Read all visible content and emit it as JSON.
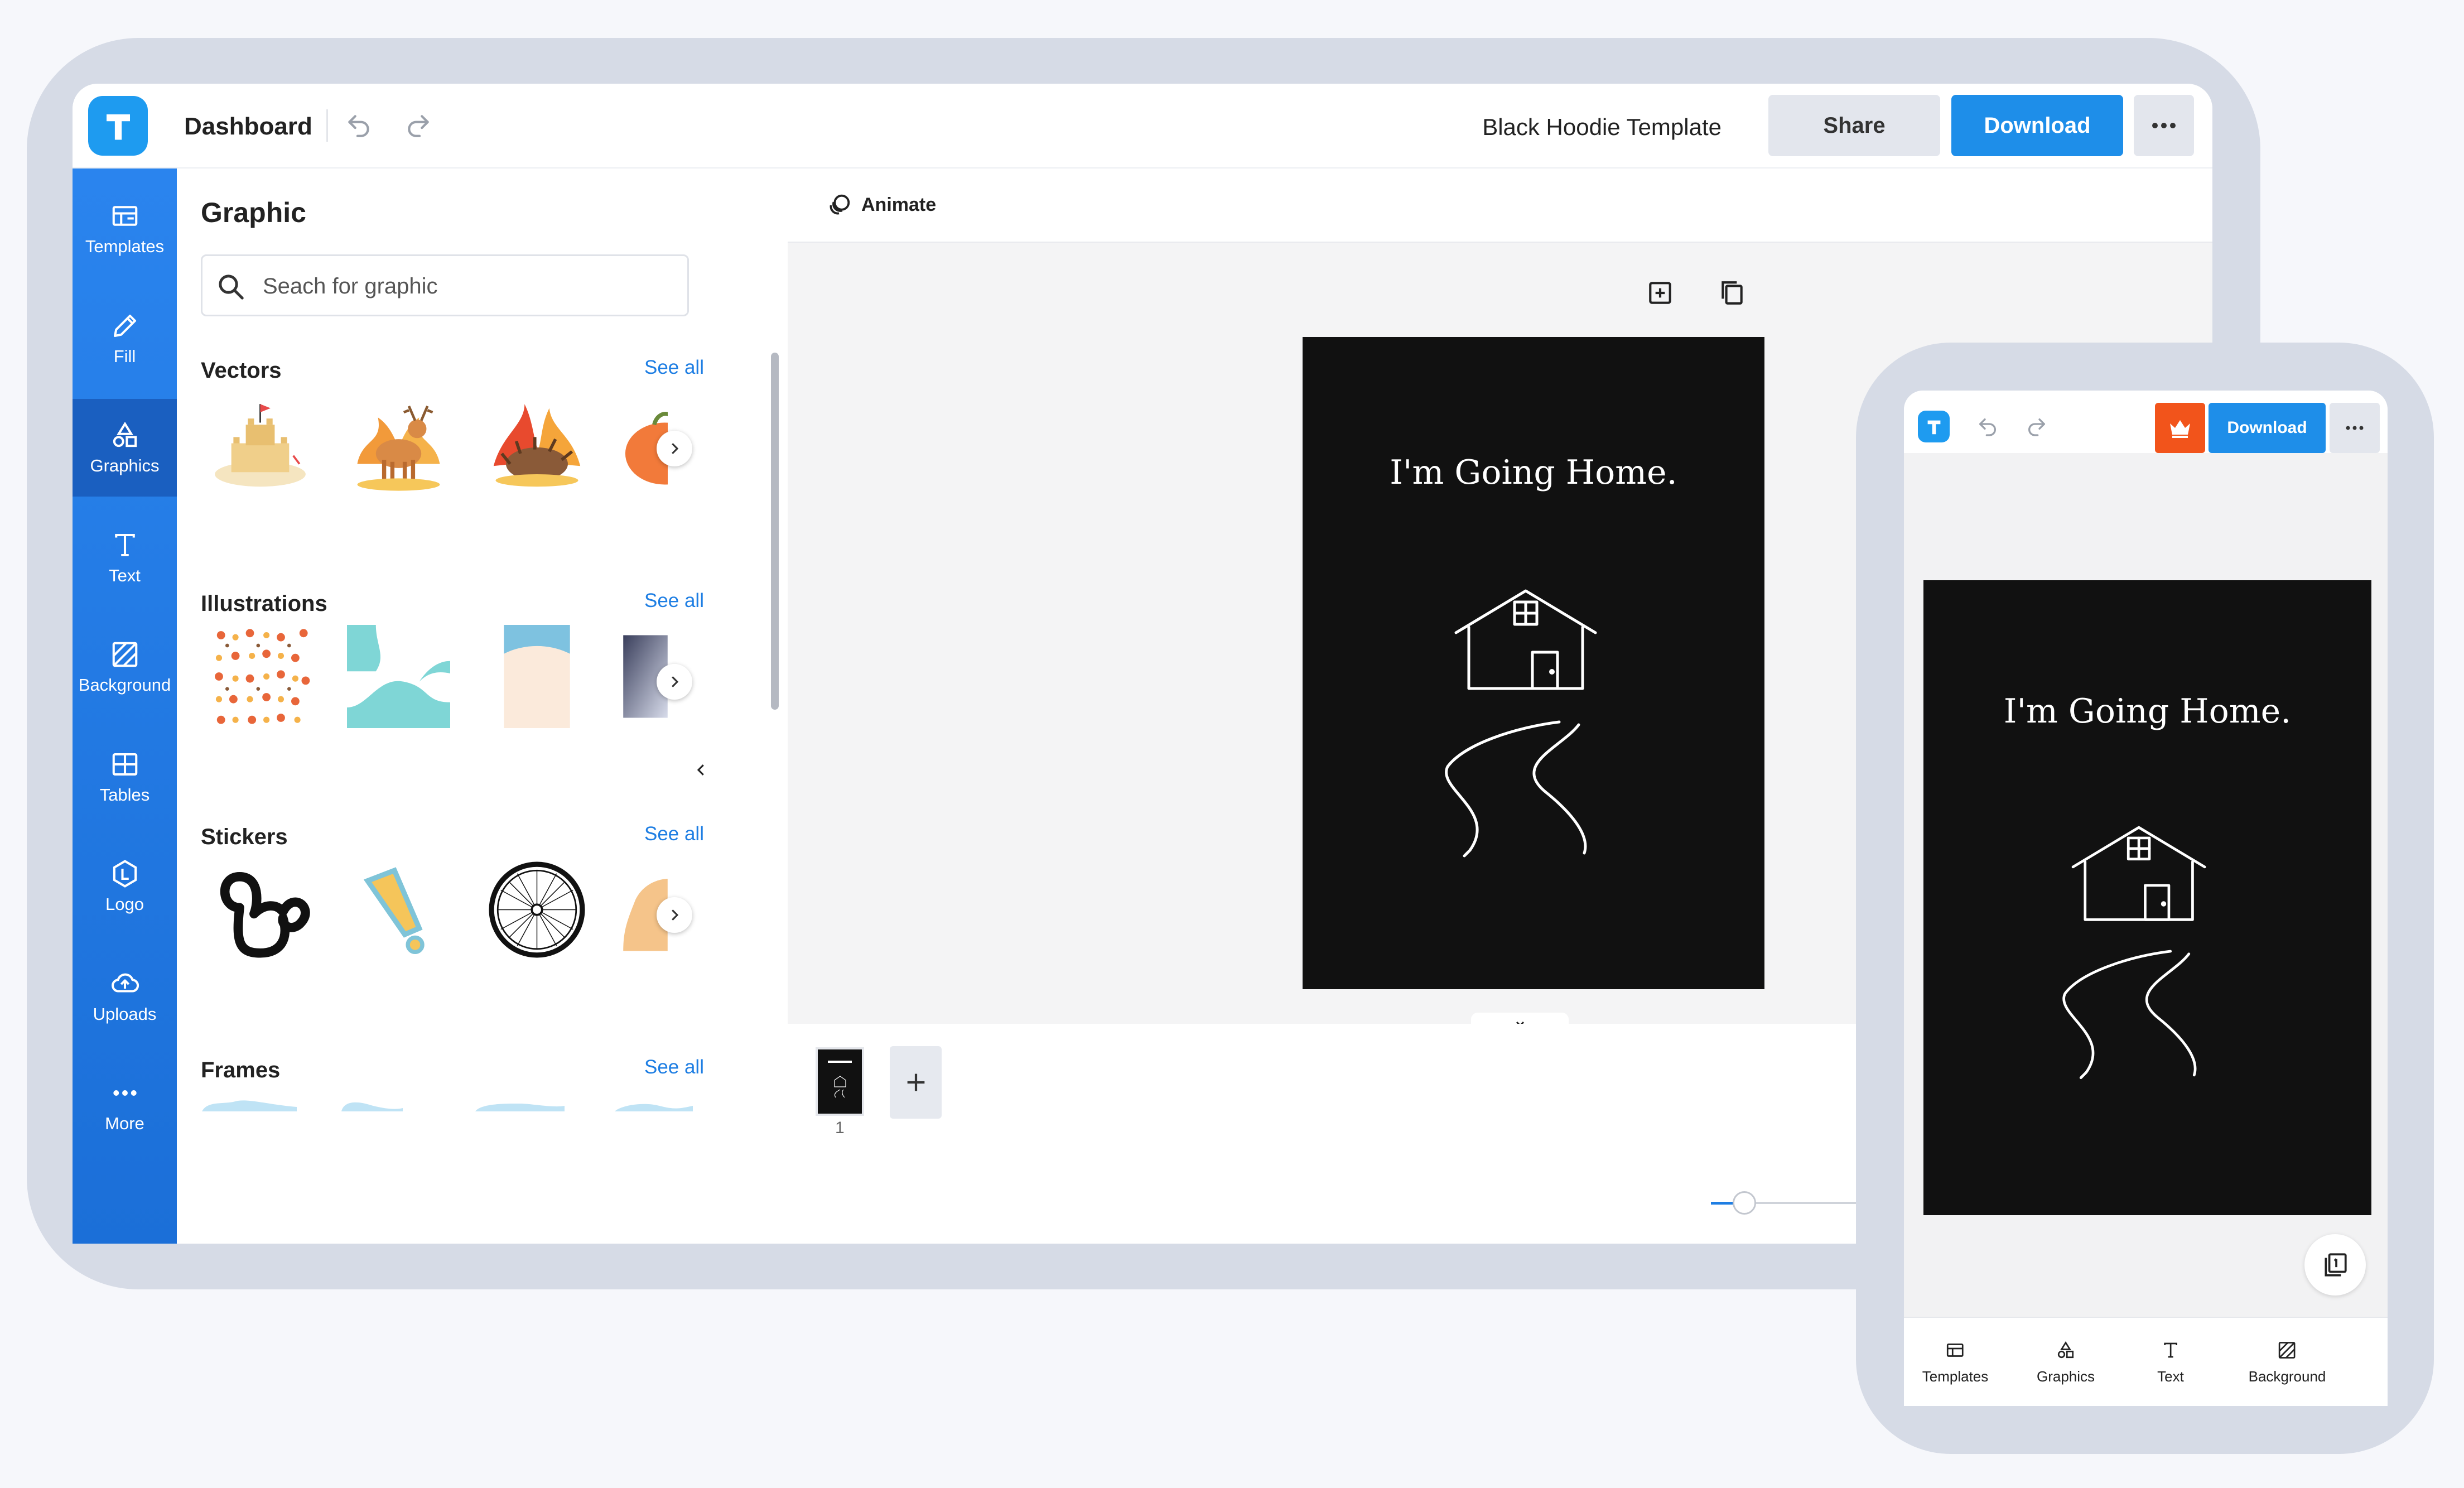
{
  "header": {
    "logo_letter": "T",
    "dashboard_label": "Dashboard",
    "document_title": "Black Hoodie Template",
    "share_label": "Share",
    "download_label": "Download"
  },
  "sidebar": {
    "items": [
      {
        "label": "Templates",
        "icon": "templates-icon"
      },
      {
        "label": "Fill",
        "icon": "pencil-icon"
      },
      {
        "label": "Graphics",
        "icon": "shapes-icon"
      },
      {
        "label": "Text",
        "icon": "text-icon"
      },
      {
        "label": "Background",
        "icon": "background-icon"
      },
      {
        "label": "Tables",
        "icon": "table-icon"
      },
      {
        "label": "Logo",
        "icon": "logo-icon"
      },
      {
        "label": "Uploads",
        "icon": "cloud-upload-icon"
      },
      {
        "label": "More",
        "icon": "more-dots-icon"
      }
    ],
    "active": "Graphics"
  },
  "panel": {
    "title": "Graphic",
    "search_placeholder": "Seach for graphic",
    "sections": [
      {
        "title": "Vectors",
        "see_all": "See all"
      },
      {
        "title": "Illustrations",
        "see_all": "See all"
      },
      {
        "title": "Stickers",
        "see_all": "See all"
      },
      {
        "title": "Frames",
        "see_all": "See all"
      }
    ]
  },
  "toolbar": {
    "animate_label": "Animate"
  },
  "canvas": {
    "headline": "I'm Going Home.",
    "background_color": "#111111"
  },
  "pages": {
    "current_page": "1"
  },
  "zoom": {
    "level_fraction": 0.1
  },
  "phone": {
    "download_label": "Download",
    "headline": "I'm Going Home.",
    "tabs": [
      {
        "label": "Templates"
      },
      {
        "label": "Graphics"
      },
      {
        "label": "Text"
      },
      {
        "label": "Background"
      }
    ]
  },
  "colors": {
    "accent": "#1e8ee9",
    "sidebar": "#2a84ee",
    "premium": "#f2541b",
    "frame": "#d6dbe6"
  }
}
